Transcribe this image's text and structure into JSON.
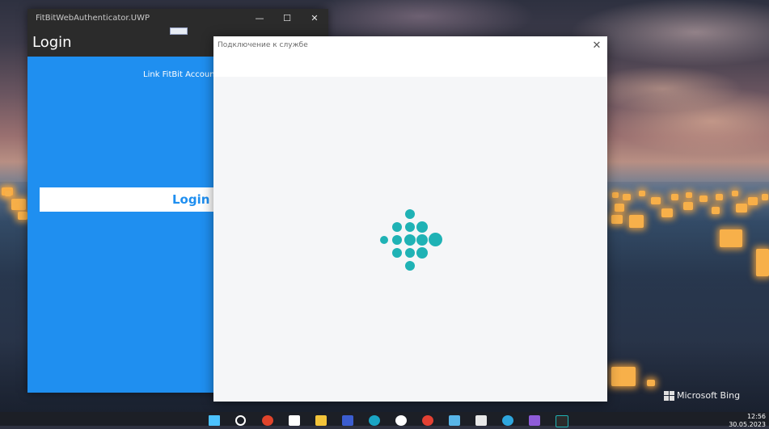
{
  "uwp_window": {
    "title": "FitBitWebAuthenticator.UWP",
    "header": "Login",
    "link_label": "Link FitBit Account",
    "login_button": "Login",
    "controls": {
      "minimize": "—",
      "maximize": "☐",
      "close": "✕"
    }
  },
  "dialog": {
    "title": "Подключение к службе",
    "close_glyph": "✕",
    "logo_icon": "fitbit-logo-icon"
  },
  "wallpaper": {
    "watermark": "Microsoft Bing"
  },
  "taskbar": {
    "time": "12:56",
    "date": "30.05.2023",
    "icons": [
      "windows-start-icon",
      "search-icon",
      "anydesk-icon",
      "store-icon",
      "file-explorer-icon",
      "floppy-save-icon",
      "edge-icon",
      "yandex-icon",
      "chrome-icon",
      "notepad-icon",
      "paint-icon",
      "telegram-icon",
      "visual-studio-icon",
      "fitbit-taskbar-icon"
    ]
  },
  "colors": {
    "accent": "#1f8ff0",
    "fitbit_teal": "#1fb2b5"
  }
}
